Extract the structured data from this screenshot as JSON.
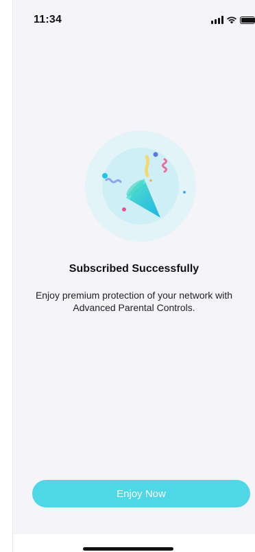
{
  "status_bar": {
    "time": "11:34"
  },
  "illustration": {
    "icon": "party-popper-icon"
  },
  "content": {
    "title": "Subscribed Successfully",
    "description": "Enjoy premium protection of your network with Advanced Parental Controls."
  },
  "actions": {
    "enjoy_now_label": "Enjoy Now"
  },
  "colors": {
    "accent": "#4ED8E6",
    "background": "#F5F5F9"
  }
}
